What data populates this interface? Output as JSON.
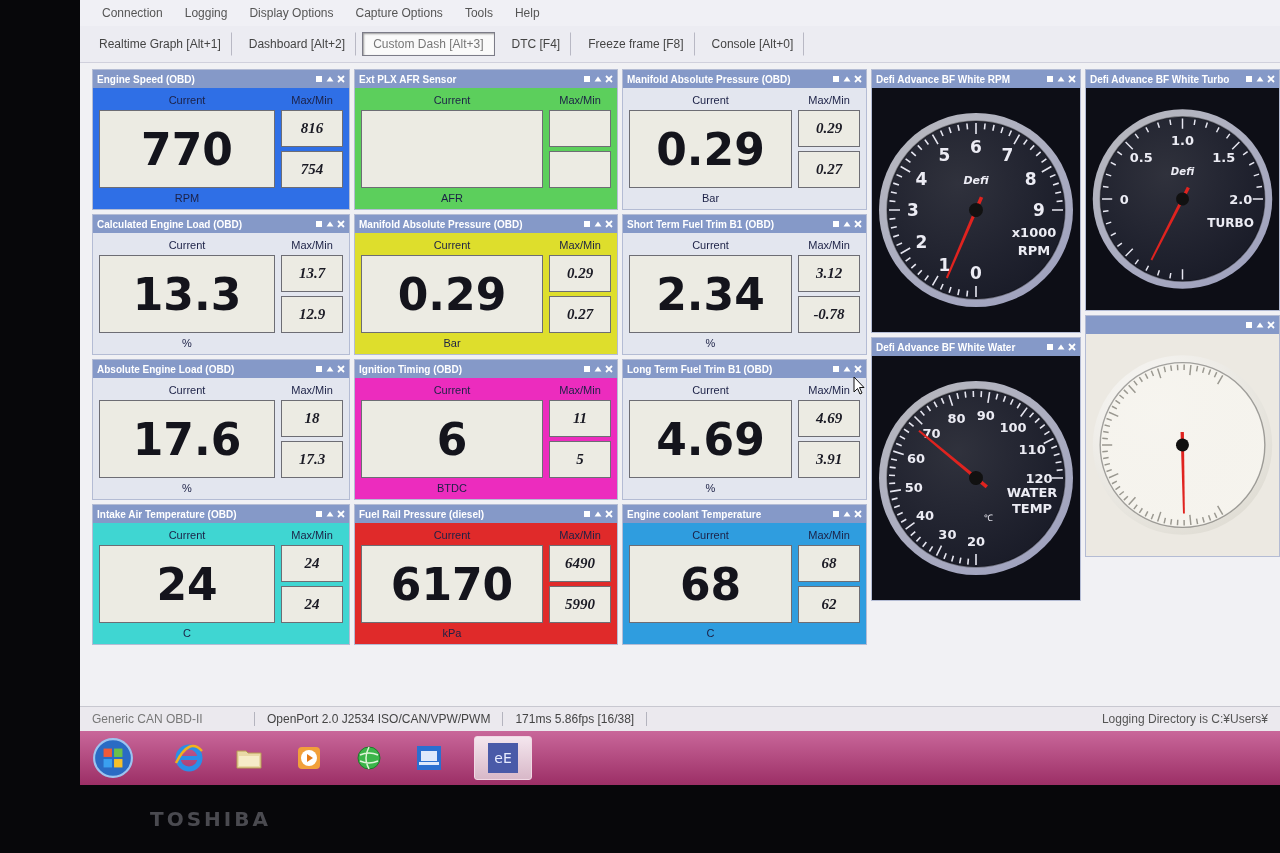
{
  "menu": [
    "Connection",
    "Logging",
    "Display Options",
    "Capture Options",
    "Tools",
    "Help"
  ],
  "toolbar": [
    {
      "label": "Realtime Graph [Alt+1]",
      "selected": false
    },
    {
      "label": "Dashboard [Alt+2]",
      "selected": false
    },
    {
      "label": "Custom Dash [Alt+3]",
      "selected": true
    },
    {
      "label": "DTC [F4]",
      "selected": false
    },
    {
      "label": "Freeze frame [F8]",
      "selected": false
    },
    {
      "label": "Console [Alt+0]",
      "selected": false
    }
  ],
  "dashboard": {
    "columns": [
      {
        "items": [
          {
            "kind": "readout",
            "title": "Engine Speed (OBD)",
            "color": "#2f6fe6",
            "current_label": "Current",
            "maxmin_label": "Max/Min",
            "current": "770",
            "max": "816",
            "min": "754",
            "unit": "RPM"
          },
          {
            "kind": "readout",
            "title": "Calculated Engine Load (OBD)",
            "color": "#e3e6ef",
            "current_label": "Current",
            "maxmin_label": "Max/Min",
            "current": "13.3",
            "max": "13.7",
            "min": "12.9",
            "unit": "%"
          },
          {
            "kind": "readout",
            "title": "Absolute Engine Load (OBD)",
            "color": "#e3e6ef",
            "current_label": "Current",
            "maxmin_label": "Max/Min",
            "current": "17.6",
            "max": "18",
            "min": "17.3",
            "unit": "%"
          },
          {
            "kind": "readout",
            "title": "Intake Air Temperature (OBD)",
            "color": "#3fd6d2",
            "current_label": "Current",
            "maxmin_label": "Max/Min",
            "current": "24",
            "max": "24",
            "min": "24",
            "unit": "C"
          }
        ]
      },
      {
        "items": [
          {
            "kind": "readout",
            "title": "Ext PLX AFR Sensor",
            "color": "#5ccf5c",
            "current_label": "Current",
            "maxmin_label": "Max/Min",
            "unit": "AFR"
          },
          {
            "kind": "readout",
            "title": "Manifold Absolute Pressure (OBD)",
            "color": "#dede2c",
            "current_label": "Current",
            "maxmin_label": "Max/Min",
            "current": "0.29",
            "max": "0.29",
            "min": "0.27",
            "unit": "Bar"
          },
          {
            "kind": "readout",
            "title": "Ignition Timing (OBD)",
            "color": "#ec2cbe",
            "current_label": "Current",
            "maxmin_label": "Max/Min",
            "current": "6",
            "max": "11",
            "min": "5",
            "unit": "BTDC"
          },
          {
            "kind": "readout",
            "title": "Fuel Rail Pressure (diesel)",
            "color": "#e02a2a",
            "current_label": "Current",
            "maxmin_label": "Max/Min",
            "current": "6170",
            "max": "6490",
            "min": "5990",
            "unit": "kPa"
          }
        ]
      },
      {
        "items": [
          {
            "kind": "readout",
            "title": "Manifold Absolute Pressure (OBD)",
            "color": "#e3e6ef",
            "current_label": "Current",
            "maxmin_label": "Max/Min",
            "current": "0.29",
            "max": "0.29",
            "min": "0.27",
            "unit": "Bar"
          },
          {
            "kind": "readout",
            "title": "Short Term Fuel Trim B1 (OBD)",
            "color": "#e3e6ef",
            "current_label": "Current",
            "maxmin_label": "Max/Min",
            "current": "2.34",
            "max": "3.12",
            "min": "-0.78",
            "unit": "%"
          },
          {
            "kind": "readout",
            "title": "Long Term Fuel Trim B1 (OBD)",
            "color": "#e3e6ef",
            "current_label": "Current",
            "maxmin_label": "Max/Min",
            "current": "4.69",
            "max": "4.69",
            "min": "3.91",
            "unit": "%"
          },
          {
            "kind": "readout",
            "title": "Engine coolant Temperature",
            "color": "#2f9ddf",
            "current_label": "Current",
            "maxmin_label": "Max/Min",
            "current": "68",
            "max": "68",
            "min": "62",
            "unit": "C"
          }
        ]
      },
      {
        "items": [
          {
            "kind": "rpm_gauge",
            "title": "Defi Advance BF White RPM",
            "labels": [
              "0",
              "1",
              "2",
              "3",
              "4",
              "5",
              "6",
              "7",
              "8",
              "9"
            ],
            "logo": "Defi",
            "captions": [
              "x1000",
              "RPM"
            ]
          },
          {
            "kind": "water_gauge",
            "title": "Defi Advance BF White Water",
            "labels": [
              "20",
              "30",
              "40",
              "50",
              "60",
              "70",
              "80",
              "90",
              "100",
              "110",
              "120"
            ],
            "captions": [
              "WATER",
              "TEMP"
            ],
            "unit_mark": "℃"
          }
        ]
      },
      {
        "items": [
          {
            "kind": "turbo_gauge",
            "title": "Defi Advance BF White Turbo",
            "labels": [
              "0",
              "0.5",
              "1.0",
              "1.5",
              "2.0"
            ],
            "logo": "Defi",
            "captions": [
              "TURBO"
            ]
          },
          {
            "kind": "plain_gauge"
          }
        ]
      }
    ]
  },
  "status_bar": [
    "Generic CAN OBD-II",
    "OpenPort 2.0 J2534 ISO/CAN/VPW/PWM",
    "171ms 5.86fps [16/38]",
    "Logging Directory is C:¥Users¥"
  ],
  "taskbar": [
    {
      "selected": false
    },
    {
      "selected": false
    },
    {
      "selected": false
    },
    {
      "selected": false
    },
    {
      "selected": false
    },
    {
      "selected": true,
      "label": "eE"
    }
  ],
  "bezel": {
    "brand": "TOSHIBA"
  }
}
